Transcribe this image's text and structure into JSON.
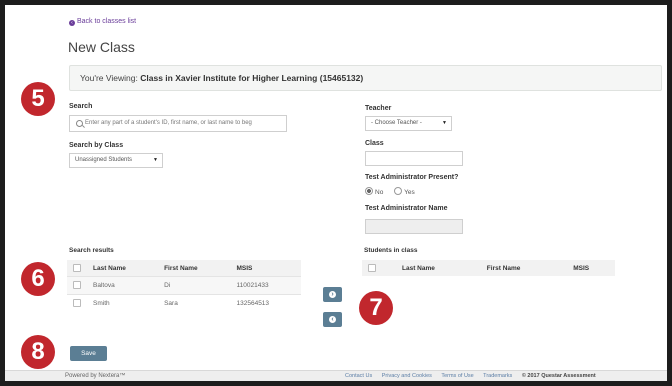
{
  "nav": {
    "back_label": "Back to classes list"
  },
  "page": {
    "title": "New Class",
    "viewing_prefix": "You're Viewing:",
    "viewing_value": "Class in Xavier Institute for Higher Learning (15465132)"
  },
  "callouts": [
    "5",
    "6",
    "7",
    "8"
  ],
  "search": {
    "label": "Search",
    "placeholder": "Enter any part of a student's ID, first name, or last name to beg",
    "by_class_label": "Search by Class",
    "by_class_value": "Unassigned Students"
  },
  "form": {
    "teacher_label": "Teacher",
    "teacher_value": "- Choose Teacher -",
    "class_label": "Class",
    "class_value": "",
    "admin_present_label": "Test Administrator Present?",
    "admin_present_options": [
      "No",
      "Yes"
    ],
    "admin_present_selected": "No",
    "admin_name_label": "Test Administrator Name",
    "admin_name_value": ""
  },
  "results": {
    "title": "Search results",
    "columns": [
      "Last Name",
      "First Name",
      "MSIS"
    ],
    "rows": [
      {
        "last": "Baltova",
        "first": "Di",
        "msis": "110021433"
      },
      {
        "last": "Smith",
        "first": "Sara",
        "msis": "132564513"
      }
    ]
  },
  "students_in_class": {
    "title": "Students in class",
    "columns": [
      "Last Name",
      "First Name",
      "MSIS"
    ]
  },
  "actions": {
    "save_label": "Save"
  },
  "footer": {
    "powered_by": "Powered by Nextera™",
    "links": [
      "Contact Us",
      "Privacy and Cookies",
      "Terms of Use",
      "Trademarks"
    ],
    "copyright": "© 2017 Questar Assessment"
  },
  "colors": {
    "callout": "#c1272d",
    "button": "#5b7e94",
    "link": "#6a3d9a"
  }
}
